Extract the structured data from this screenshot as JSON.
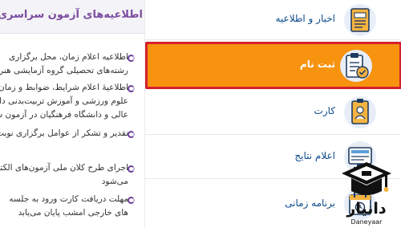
{
  "news": {
    "title": "اطلاعیه‌های آزمون سراسری",
    "items": [
      {
        "lines": [
          "اطلاعیه اعلام زمان، محل برگزاری",
          "رشته‌های تحصیلی گروه آزمایشی هنر"
        ]
      },
      {
        "lines": [
          "اطلاعیهٔ اعلام شرایط، ضوابط و زمان",
          "علوم ورزشی و آموزش تربیت‌بدنی دانشگاه",
          "عالی و دانشگاه فرهنگیان در آزمون سراسری"
        ]
      },
      {
        "lines": [
          "تقدیر و تشکر از عوامل برگزاری نوبت"
        ]
      },
      {
        "lines": [
          "اجرای طرح کلان ملی آزمون‌های الکترونیکی",
          "می‌شود"
        ]
      },
      {
        "lines": [
          "مهلت دریافت کارت ورود به جلسه",
          "های خارجی امشب پایان می‌یابد"
        ]
      }
    ]
  },
  "menu": {
    "items": [
      {
        "label": "اخبار و اطلاعیه",
        "icon": "news-icon"
      },
      {
        "label": "ثبت نام",
        "icon": "registration-clipboard-icon",
        "active": true
      },
      {
        "label": "کارت",
        "icon": "id-card-icon"
      },
      {
        "label": "اعلام نتایج",
        "icon": "results-screen-icon"
      },
      {
        "label": "برنامه زمانی",
        "icon": "schedule-icon"
      }
    ]
  },
  "colors": {
    "active_bg": "#f7930f",
    "active_border": "#d6202c",
    "label": "#0c4a8a",
    "news_title": "#7a4c9f"
  },
  "watermark": {
    "brand": "Daneyaar",
    "brand_fa": "دانیار"
  }
}
